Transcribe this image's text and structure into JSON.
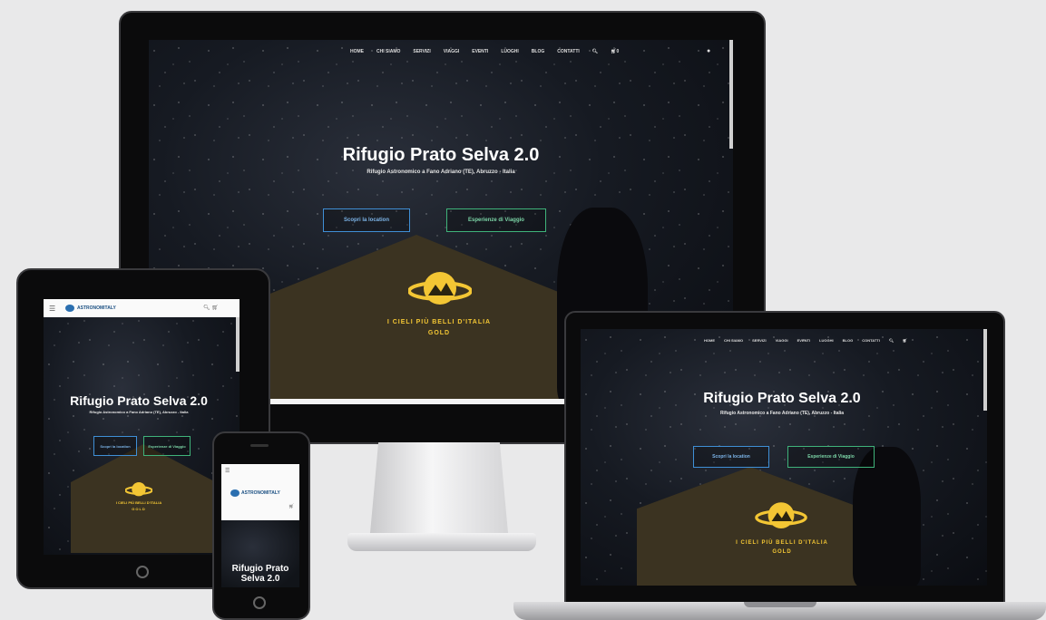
{
  "site": {
    "title": "Rifugio Prato Selva 2.0",
    "subtitle": "Rifugio Astronomico a Fano Adriano (TE), Abruzzo - Italia",
    "subtitle_short": "Rifugio Astronomico a Fano Adriano (TE), Abruzzo - Italia",
    "buttons": {
      "location": "Scopri la location",
      "experience": "Esperienze di Viaggio"
    },
    "nav": [
      "HOME",
      "CHI SIAMO",
      "SERVIZI",
      "VIAGGI",
      "EVENTI",
      "LUOGHI",
      "BLOG",
      "CONTATTI"
    ],
    "cart_count": "0",
    "brand": "ASTRONOMITALY",
    "badge": {
      "line1": "I CIELI PIÙ BELLI D'ITALIA",
      "line2": "GOLD"
    },
    "tablet_buttons": {
      "location": "Scopri la location",
      "experience": "Esperienze di Viaggio"
    },
    "phone_title": "Rifugio Prato Selva 2.0"
  },
  "icons": {
    "search": "search-icon",
    "cart": "cart-icon",
    "user": "user-icon",
    "menu": "hamburger-icon"
  },
  "colors": {
    "background": "#e9e9ea",
    "accent_blue": "#3f8fd6",
    "accent_green": "#3fb37a",
    "gold": "#f3c634"
  }
}
